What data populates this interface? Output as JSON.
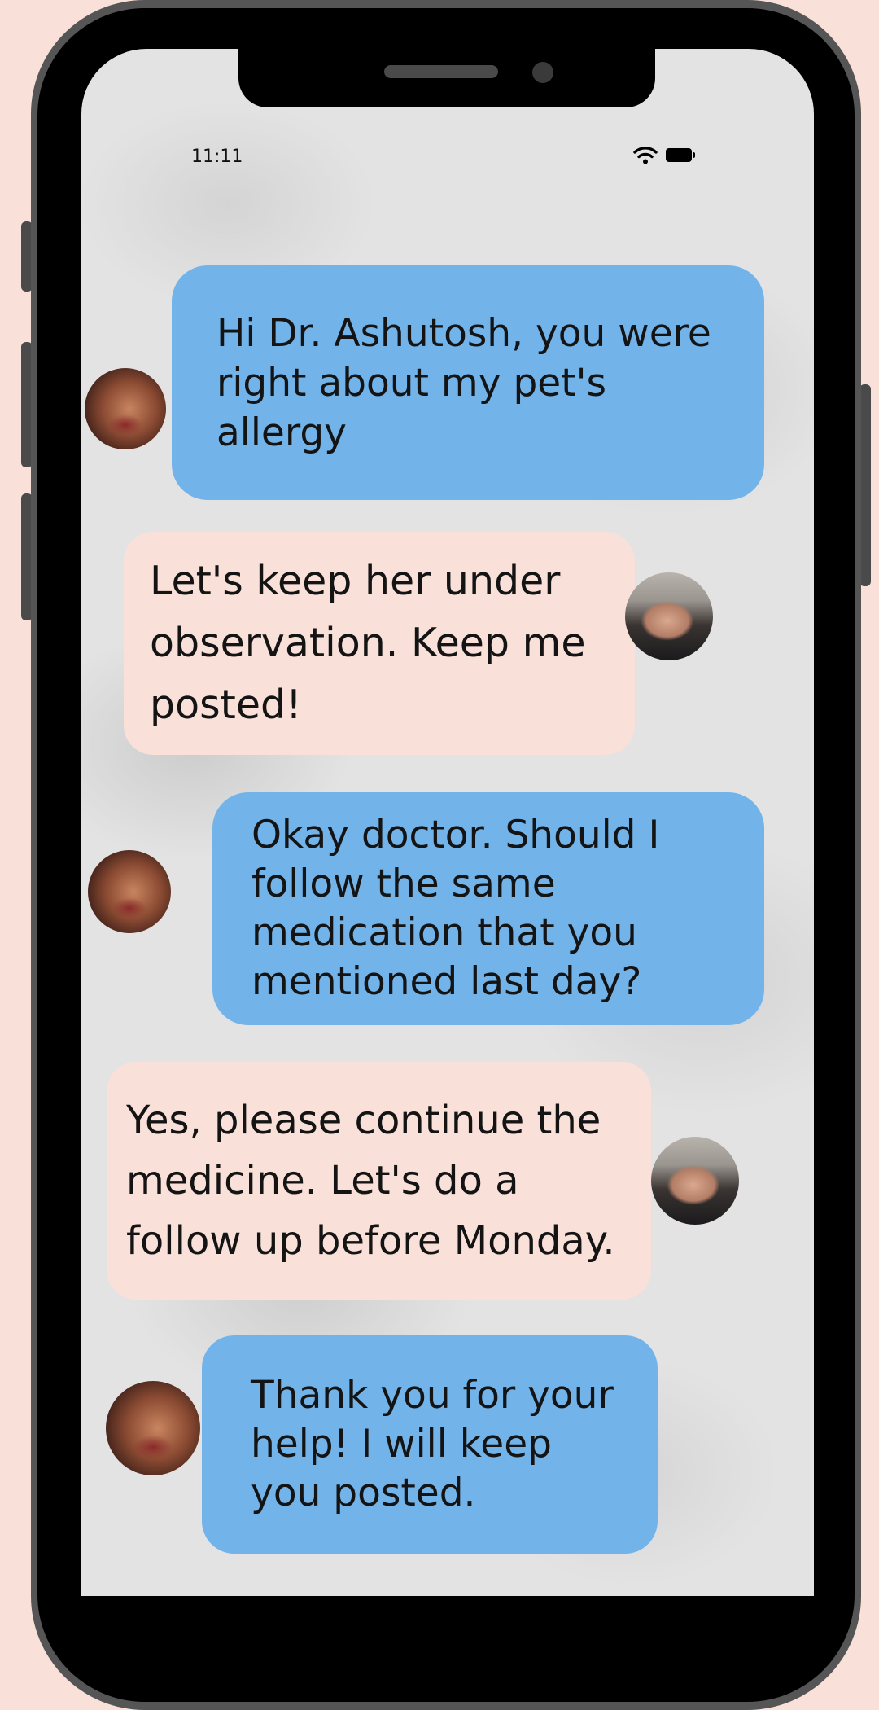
{
  "status_bar": {
    "time": "11:11",
    "wifi_icon": "wifi-icon",
    "battery_icon": "battery-icon"
  },
  "colors": {
    "page_background": "#f9e1da",
    "patient_bubble": "#72b3e9",
    "doctor_bubble": "#f9e1da",
    "phone_frame": "#555555"
  },
  "messages": [
    {
      "sender": "patient",
      "text": "Hi Dr. Ashutosh, you were right about my pet's allergy"
    },
    {
      "sender": "doctor",
      "text": "Let's keep her under observation.  Keep me posted!"
    },
    {
      "sender": "patient",
      "text": "Okay doctor. Should I follow the same medication that you mentioned last day?"
    },
    {
      "sender": "doctor",
      "text": "Yes, please continue the medicine. Let's do a follow up before Monday."
    },
    {
      "sender": "patient",
      "text": "Thank you for your help! I will keep you posted."
    }
  ]
}
